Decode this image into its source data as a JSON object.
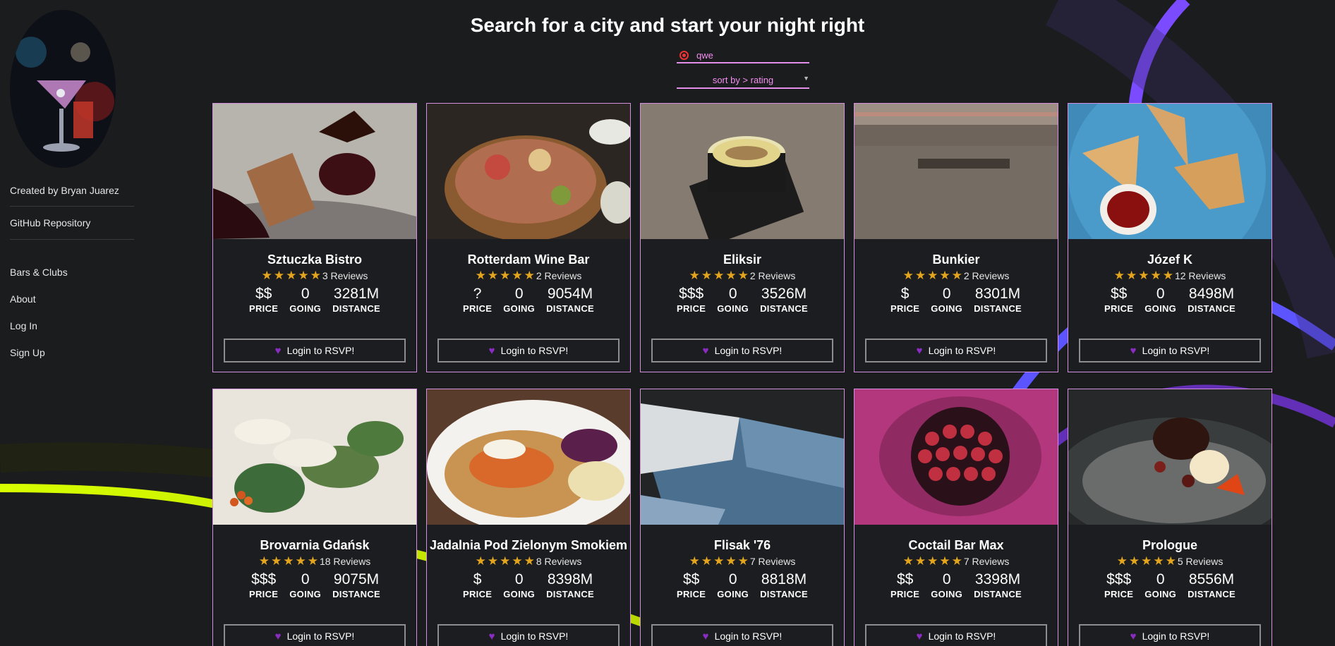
{
  "sidebar": {
    "created_by": "Created by Bryan Juarez",
    "github": "GitHub Repository",
    "nav": [
      "Bars & Clubs",
      "About",
      "Log In",
      "Sign Up"
    ]
  },
  "header": {
    "title": "Search for a city and start your night right"
  },
  "search": {
    "value": "qwe",
    "icon": "search-icon"
  },
  "sort": {
    "label": "sort by > rating"
  },
  "labels": {
    "price": "PRICE",
    "going": "GOING",
    "distance": "DISTANCE",
    "rsvp": "Login to RSVP!",
    "reviews_suffix": " Reviews"
  },
  "colors": {
    "accent": "#e38ee8",
    "star": "#e3a51e",
    "heart": "#8a2cc2",
    "background": "#1b1c1e"
  },
  "venues": [
    {
      "name": "Sztuczka Bistro",
      "rating": 5,
      "reviews": "3 Reviews",
      "price": "$$",
      "going": "0",
      "distance": "3281M",
      "image": "dessert-plate-image"
    },
    {
      "name": "Rotterdam Wine Bar",
      "rating": 5,
      "reviews": "2 Reviews",
      "price": "?",
      "going": "0",
      "distance": "9054M",
      "image": "charcuterie-board-image"
    },
    {
      "name": "Eliksir",
      "rating": 5,
      "reviews": "2 Reviews",
      "price": "$$$",
      "going": "0",
      "distance": "3526M",
      "image": "coffee-cup-image"
    },
    {
      "name": "Bunkier",
      "rating": 5,
      "reviews": "2 Reviews",
      "price": "$",
      "going": "0",
      "distance": "8301M",
      "image": "wall-sign-image"
    },
    {
      "name": "Józef K",
      "rating": 5,
      "reviews": "12 Reviews",
      "price": "$$",
      "going": "0",
      "distance": "8498M",
      "image": "sandwich-plate-image"
    },
    {
      "name": "Brovarnia Gdańsk",
      "rating": 5,
      "reviews": "18 Reviews",
      "price": "$$$",
      "going": "0",
      "distance": "9075M",
      "image": "dumplings-image"
    },
    {
      "name": "Jadalnia Pod Zielonym Smokiem",
      "rating": 5,
      "reviews": "8 Reviews",
      "price": "$",
      "going": "0",
      "distance": "8398M",
      "image": "crepe-plate-image"
    },
    {
      "name": "Flisak '76",
      "rating": 5,
      "reviews": "7 Reviews",
      "price": "$$",
      "going": "0",
      "distance": "8818M",
      "image": "magazine-image"
    },
    {
      "name": "Coctail Bar Max",
      "rating": 5,
      "reviews": "7 Reviews",
      "price": "$$",
      "going": "0",
      "distance": "3398M",
      "image": "shot-glasses-image"
    },
    {
      "name": "Prologue",
      "rating": 5,
      "reviews": "5 Reviews",
      "price": "$$$",
      "going": "0",
      "distance": "8556M",
      "image": "chocolate-dessert-image"
    }
  ]
}
